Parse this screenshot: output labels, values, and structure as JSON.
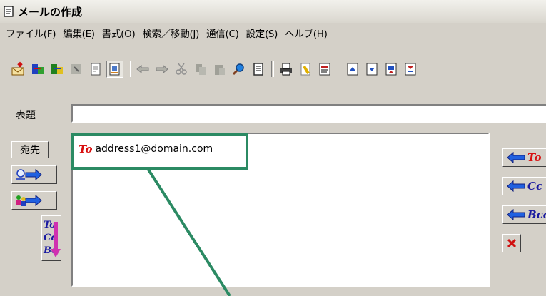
{
  "window": {
    "title": "メールの作成"
  },
  "menu": [
    "ファイル(F)",
    "編集(E)",
    "書式(O)",
    "検索／移動(J)",
    "通信(C)",
    "設定(S)",
    "ヘルプ(H)"
  ],
  "compose": {
    "subject_label": "表題",
    "subject_value": "",
    "to_button_label": "宛先",
    "recipients": [
      {
        "tag": "To",
        "address": "address1@domain.com"
      }
    ]
  },
  "right_buttons": [
    {
      "label": "To",
      "icon": "arrow-left-icon"
    },
    {
      "label": "Cc",
      "icon": "arrow-left-icon"
    },
    {
      "label": "Bcc",
      "icon": "arrow-left-icon"
    }
  ],
  "annotation": {
    "color": "#2b8a63"
  }
}
